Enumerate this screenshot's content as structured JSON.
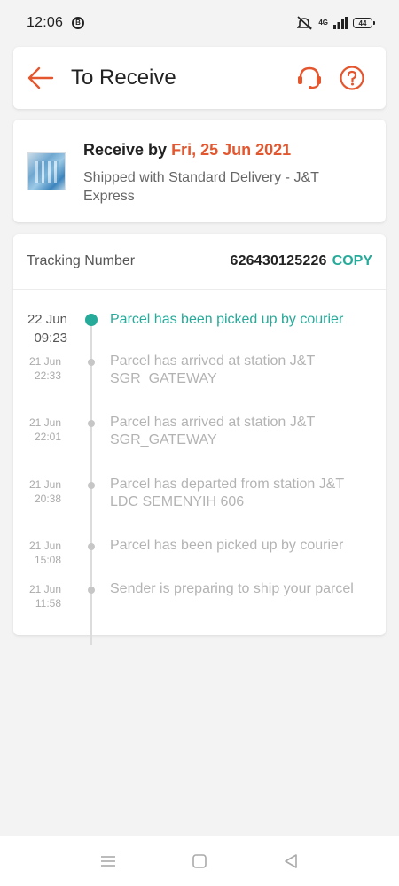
{
  "status_bar": {
    "time": "12:06",
    "badge": "B",
    "network": "4G",
    "battery": "44"
  },
  "header": {
    "title": "To Receive",
    "back_icon": "arrow-left-icon",
    "support_icon": "headset-icon",
    "help_icon": "question-circle-icon"
  },
  "delivery": {
    "receive_prefix": "Receive by ",
    "receive_date": "Fri, 25 Jun 2021",
    "shipping_info": "Shipped with Standard Delivery  - J&T Express"
  },
  "tracking": {
    "label": "Tracking Number",
    "number": "626430125226",
    "copy_label": "COPY",
    "events": [
      {
        "date": "22 Jun",
        "time": "09:23",
        "text": "Parcel has been picked up by courier",
        "active": true
      },
      {
        "date": "21 Jun",
        "time": "22:33",
        "text": "Parcel has arrived at station J&T SGR_GATEWAY",
        "active": false
      },
      {
        "date": "21 Jun",
        "time": "22:01",
        "text": "Parcel has arrived at station J&T SGR_GATEWAY",
        "active": false
      },
      {
        "date": "21 Jun",
        "time": "20:38",
        "text": "Parcel has departed from station J&T LDC SEMENYIH 606",
        "active": false
      },
      {
        "date": "21 Jun",
        "time": "15:08",
        "text": "Parcel has been picked up by courier",
        "active": false
      },
      {
        "date": "21 Jun",
        "time": "11:58",
        "text": "Sender is preparing to ship your parcel",
        "active": false
      }
    ]
  },
  "nav_bar": {
    "menu_icon": "menu-icon",
    "home_icon": "home-square-icon",
    "back_icon": "back-triangle-icon"
  },
  "colors": {
    "accent_orange": "#e4562e",
    "accent_teal": "#26aa99",
    "background": "#f3f3f3"
  }
}
